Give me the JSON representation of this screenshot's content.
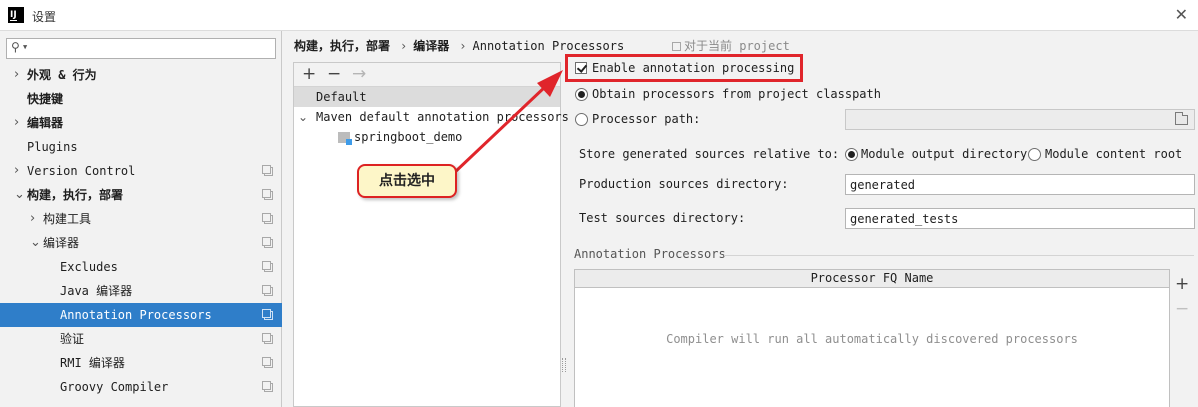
{
  "window": {
    "title": "设置",
    "logo_text": "IJ"
  },
  "sidebar": {
    "search": {
      "value": "",
      "placeholder": ""
    },
    "items": [
      {
        "label": "外观 & 行为",
        "arrow": "›",
        "bold": true
      },
      {
        "label": "快捷键",
        "arrow": "",
        "bold": true
      },
      {
        "label": "编辑器",
        "arrow": "›",
        "bold": true
      },
      {
        "label": "Plugins",
        "arrow": "",
        "bold": false
      },
      {
        "label": "Version Control",
        "arrow": "›",
        "bold": false
      },
      {
        "label": "构建，执行，部署",
        "arrow": "⌄",
        "bold": true
      },
      {
        "label": "构建工具",
        "arrow": "›",
        "bold": false
      },
      {
        "label": "编译器",
        "arrow": "⌄",
        "bold": false
      },
      {
        "label": "Excludes",
        "arrow": "",
        "bold": false
      },
      {
        "label": "Java 编译器",
        "arrow": "",
        "bold": false
      },
      {
        "label": "Annotation Processors",
        "arrow": "",
        "bold": false,
        "selected": true
      },
      {
        "label": "验证",
        "arrow": "",
        "bold": false
      },
      {
        "label": "RMI 编译器",
        "arrow": "",
        "bold": false
      },
      {
        "label": "Groovy Compiler",
        "arrow": "",
        "bold": false
      }
    ]
  },
  "breadcrumb": {
    "parts": [
      "构建，执行，部署",
      "编译器",
      "Annotation Processors"
    ],
    "separator": "›",
    "project_note": "对于当前 project"
  },
  "profiles": {
    "toolbar": {
      "add": "+",
      "remove": "−",
      "move": "→"
    },
    "default_label": "Default",
    "maven_label": "Maven default annotation processors",
    "maven_arrow": "⌄",
    "module_label": "springboot_demo"
  },
  "settings": {
    "enable_label": "Enable annotation processing",
    "obtain_label": "Obtain processors from project classpath",
    "processor_path_label": "Processor path:",
    "processor_path_value": "",
    "store_label": "Store generated sources relative to:",
    "module_output_label": "Module output directory",
    "module_content_label": "Module content root",
    "prod_label": "Production sources directory:",
    "prod_value": "generated",
    "test_label": "Test sources directory:",
    "test_value": "generated_tests",
    "section_title": "Annotation Processors",
    "table_header": "Processor FQ Name",
    "table_empty": "Compiler will run all automatically discovered processors",
    "add_btn": "+",
    "remove_btn": "−"
  },
  "annotation": {
    "callout_text": "点击选中",
    "color": "#e0252b"
  }
}
